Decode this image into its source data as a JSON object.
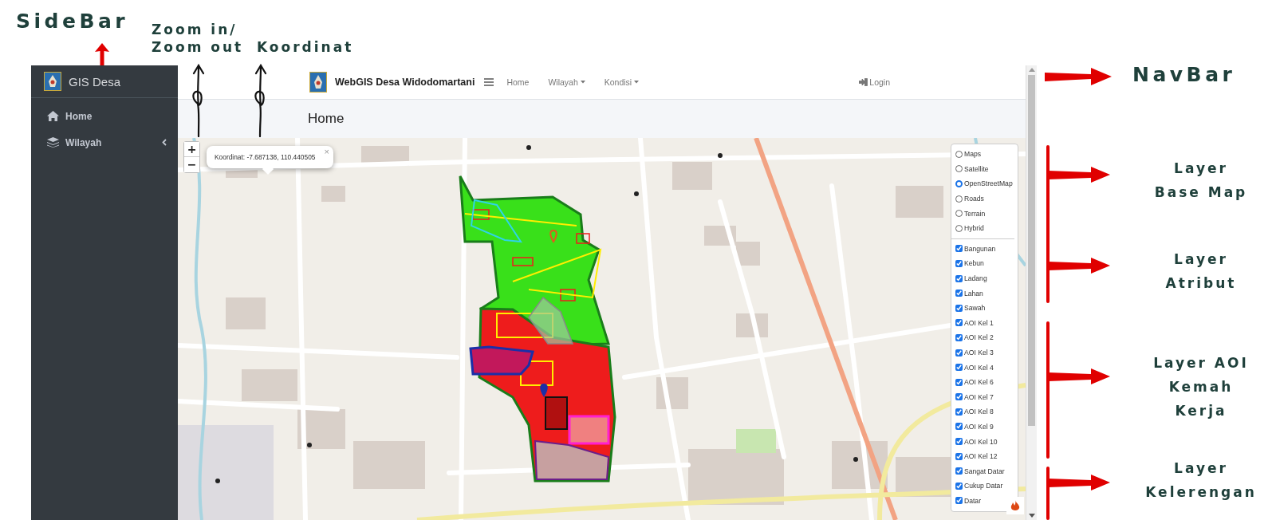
{
  "annotations": {
    "sidebar": [
      "SideBar"
    ],
    "zoom": [
      "Zoom in/",
      "Zoom out"
    ],
    "koordinat": [
      "Koordinat"
    ],
    "navbar": [
      "NavBar"
    ],
    "base_map": [
      "Layer",
      "Base Map"
    ],
    "atribut": [
      "Layer",
      "Atribut"
    ],
    "aoi": [
      "Layer AOI",
      "Kemah",
      "Kerja"
    ],
    "kelerengan": [
      "Layer",
      "Kelerengan"
    ]
  },
  "sidebar": {
    "brand": "GIS Desa",
    "items": [
      {
        "label": "Home",
        "expandable": false
      },
      {
        "label": "Wilayah",
        "expandable": true
      }
    ]
  },
  "navbar": {
    "brand": "WebGIS Desa Widodomartani",
    "links": [
      {
        "label": "Home",
        "dropdown": false
      },
      {
        "label": "Wilayah",
        "dropdown": true
      },
      {
        "label": "Kondisi",
        "dropdown": true
      }
    ],
    "login": "Login"
  },
  "page_header": {
    "title": "Home"
  },
  "map": {
    "zoom_in": "+",
    "zoom_out": "−",
    "popup": {
      "text": "Koordinat: -7.687138, 110.440505",
      "close": "×"
    },
    "base_layers": [
      {
        "label": "Maps",
        "selected": false
      },
      {
        "label": "Satellite",
        "selected": false
      },
      {
        "label": "OpenStreetMap",
        "selected": true
      },
      {
        "label": "Roads",
        "selected": false
      },
      {
        "label": "Terrain",
        "selected": false
      },
      {
        "label": "Hybrid",
        "selected": false
      }
    ],
    "overlays": [
      {
        "label": "Bangunan",
        "checked": true
      },
      {
        "label": "Kebun",
        "checked": true
      },
      {
        "label": "Ladang",
        "checked": true
      },
      {
        "label": "Lahan",
        "checked": true
      },
      {
        "label": "Sawah",
        "checked": true
      },
      {
        "label": "AOI Kel 1",
        "checked": true
      },
      {
        "label": "AOI Kel 2",
        "checked": true
      },
      {
        "label": "AOI Kel 3",
        "checked": true
      },
      {
        "label": "AOI Kel 4",
        "checked": true
      },
      {
        "label": "AOI Kel 6",
        "checked": true
      },
      {
        "label": "AOI Kel 7",
        "checked": true
      },
      {
        "label": "AOI Kel 8",
        "checked": true
      },
      {
        "label": "AOI Kel 9",
        "checked": true
      },
      {
        "label": "AOI Kel 10",
        "checked": true
      },
      {
        "label": "AOI Kel 12",
        "checked": true
      },
      {
        "label": "Sangat Datar",
        "checked": true
      },
      {
        "label": "Cukup Datar",
        "checked": true
      },
      {
        "label": "Datar",
        "checked": true
      }
    ]
  }
}
